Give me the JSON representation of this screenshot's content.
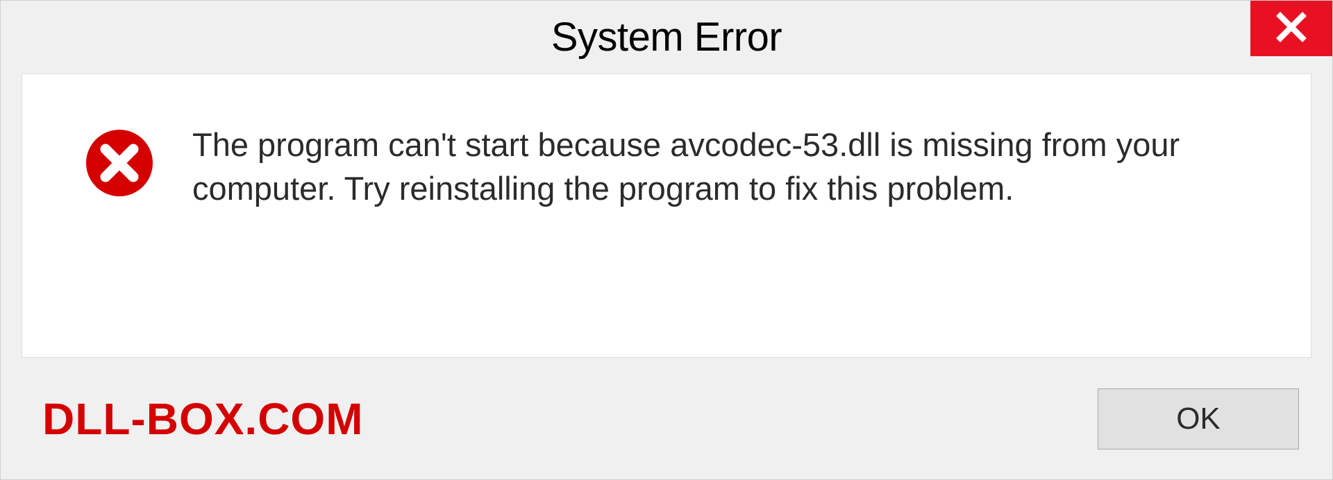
{
  "titlebar": {
    "title": "System Error"
  },
  "message": {
    "text": "The program can't start because avcodec-53.dll is missing from your computer. Try reinstalling the program to fix this problem."
  },
  "footer": {
    "watermark": "DLL-BOX.COM",
    "ok_label": "OK"
  }
}
